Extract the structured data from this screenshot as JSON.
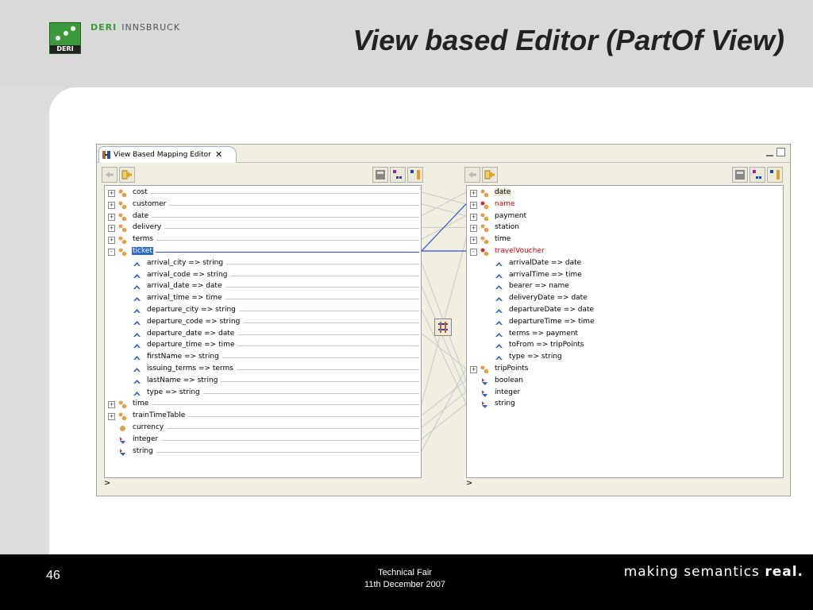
{
  "slide": {
    "title": "View based Editor (PartOf View)",
    "brand_deri": "DERI",
    "brand_innsbruck": "INNSBRUCK",
    "logo_text": "DERI",
    "page_number": "46",
    "footer_line1": "Technical Fair",
    "footer_line2": "11th December 2007",
    "tagline_prefix": "making semantics",
    "tagline_bold": "real."
  },
  "editor": {
    "tab_label": "View Based Mapping Editor",
    "tab_close": "✕",
    "left_status": ">",
    "right_status": ">"
  },
  "left_tree": [
    {
      "label": "cost",
      "kind": "concept",
      "expand": "+",
      "depth": 0
    },
    {
      "label": "customer",
      "kind": "concept",
      "expand": "+",
      "depth": 0
    },
    {
      "label": "date",
      "kind": "concept",
      "expand": "+",
      "depth": 0
    },
    {
      "label": "delivery",
      "kind": "concept",
      "expand": "+",
      "depth": 0
    },
    {
      "label": "terms",
      "kind": "concept",
      "expand": "+",
      "depth": 0
    },
    {
      "label": "ticket",
      "kind": "concept",
      "expand": "-",
      "depth": 0,
      "selected": true
    },
    {
      "label": "arrival_city => string",
      "kind": "attr",
      "depth": 1
    },
    {
      "label": "arrival_code => string",
      "kind": "attr",
      "depth": 1
    },
    {
      "label": "arrival_date => date",
      "kind": "attr",
      "depth": 1
    },
    {
      "label": "arrival_time => time",
      "kind": "attr",
      "depth": 1
    },
    {
      "label": "departure_city => string",
      "kind": "attr",
      "depth": 1
    },
    {
      "label": "departure_code => string",
      "kind": "attr",
      "depth": 1
    },
    {
      "label": "departure_date => date",
      "kind": "attr",
      "depth": 1
    },
    {
      "label": "departure_time => time",
      "kind": "attr",
      "depth": 1
    },
    {
      "label": "firstName => string",
      "kind": "attr",
      "depth": 1
    },
    {
      "label": "issuing_terms => terms",
      "kind": "attr",
      "depth": 1
    },
    {
      "label": "lastName => string",
      "kind": "attr",
      "depth": 1
    },
    {
      "label": "type => string",
      "kind": "attr",
      "depth": 1
    },
    {
      "label": "time",
      "kind": "concept",
      "expand": "+",
      "depth": 0
    },
    {
      "label": "trainTimeTable",
      "kind": "concept",
      "expand": "+",
      "depth": 0
    },
    {
      "label": "currency",
      "kind": "instance",
      "depth": 0
    },
    {
      "label": "integer",
      "kind": "datatype",
      "depth": 0
    },
    {
      "label": "string",
      "kind": "datatype",
      "depth": 0
    }
  ],
  "right_tree": [
    {
      "label": "date",
      "kind": "concept",
      "expand": "+",
      "depth": 0,
      "highlight": true
    },
    {
      "label": "name",
      "kind": "concept-red",
      "expand": "+",
      "depth": 0,
      "red": true
    },
    {
      "label": "payment",
      "kind": "concept",
      "expand": "+",
      "depth": 0
    },
    {
      "label": "station",
      "kind": "concept",
      "expand": "+",
      "depth": 0
    },
    {
      "label": "time",
      "kind": "concept",
      "expand": "+",
      "depth": 0
    },
    {
      "label": "travelVoucher",
      "kind": "concept-red",
      "expand": "-",
      "depth": 0,
      "red": true
    },
    {
      "label": "arrivalDate => date",
      "kind": "attr",
      "depth": 1
    },
    {
      "label": "arrivalTime => time",
      "kind": "attr",
      "depth": 1
    },
    {
      "label": "bearer => name",
      "kind": "attr",
      "depth": 1
    },
    {
      "label": "deliveryDate => date",
      "kind": "attr",
      "depth": 1
    },
    {
      "label": "departureDate => date",
      "kind": "attr",
      "depth": 1
    },
    {
      "label": "departureTime => time",
      "kind": "attr",
      "depth": 1
    },
    {
      "label": "terms => payment",
      "kind": "attr",
      "depth": 1
    },
    {
      "label": "toFrom => tripPoints",
      "kind": "attr",
      "depth": 1
    },
    {
      "label": "type => string",
      "kind": "attr",
      "depth": 1
    },
    {
      "label": "tripPoints",
      "kind": "concept",
      "expand": "+",
      "depth": 0
    },
    {
      "label": "boolean",
      "kind": "datatype",
      "depth": 0
    },
    {
      "label": "integer",
      "kind": "datatype",
      "depth": 0
    },
    {
      "label": "string",
      "kind": "datatype",
      "depth": 0
    }
  ],
  "colors": {
    "selection": "#316ac5",
    "mapping_line_active": "#3050c8",
    "mapping_line": "#c8c8c8",
    "accent_green": "#3a9a3a",
    "red_label": "#dd0000"
  },
  "icons": {
    "concept": "concept-icon",
    "attr": "attribute-icon",
    "instance": "instance-icon",
    "datatype": "datatype-icon",
    "map": "map-button-icon"
  }
}
